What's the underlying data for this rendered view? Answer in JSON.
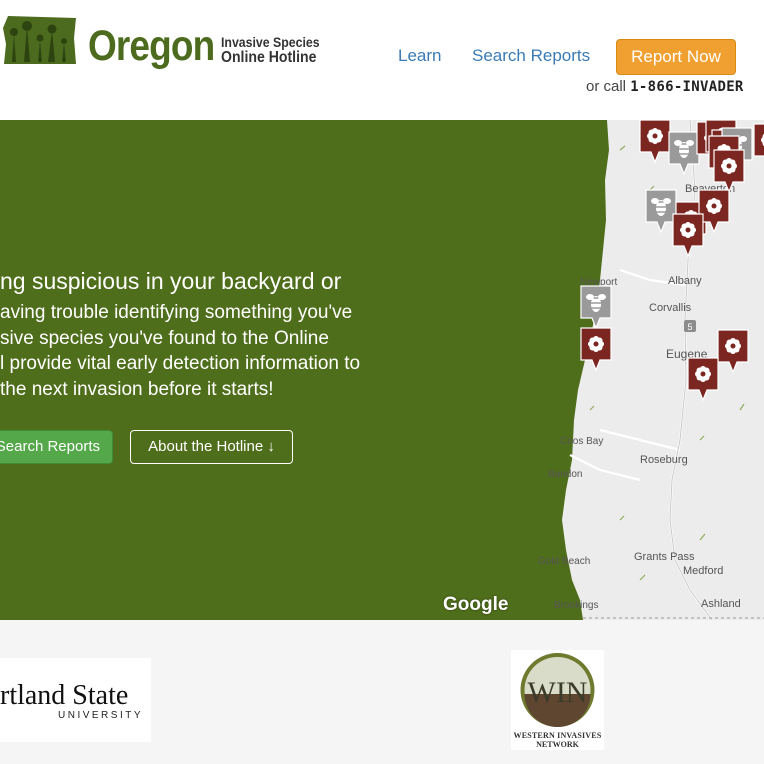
{
  "header": {
    "logo": {
      "wordmark": "Oregon",
      "subtitle_line1": "Invasive Species",
      "subtitle_line2": "Online Hotline"
    },
    "nav": [
      {
        "label": "Learn"
      },
      {
        "label": "Search Reports"
      }
    ],
    "report_button": "Report Now",
    "call_prefix": "or call",
    "phone": "1-866-INVADER"
  },
  "hero": {
    "title": "ng suspicious in your backyard or",
    "body_lines": [
      "aving trouble identifying something you've",
      "sive species you've found to the Online",
      "l provide vital early detection information to",
      " the next invasion before it starts!"
    ],
    "search_button": "Search Reports",
    "about_button": "About the Hotline ↓",
    "background_color": "#4f6e1b"
  },
  "map": {
    "google_mark": "Google",
    "places": [
      {
        "name": "Beaverton"
      },
      {
        "name": "Newport"
      },
      {
        "name": "Albany"
      },
      {
        "name": "Corvallis"
      },
      {
        "name": "Eugene"
      },
      {
        "name": "Coos Bay"
      },
      {
        "name": "Bandon"
      },
      {
        "name": "Roseburg"
      },
      {
        "name": "Gold Beach"
      },
      {
        "name": "Grants Pass"
      },
      {
        "name": "Medford"
      },
      {
        "name": "Brookings"
      },
      {
        "name": "Ashland"
      }
    ],
    "route_shield": "5",
    "marker_colors": {
      "plant": "#7b2621",
      "insect": "#9a9a9a"
    }
  },
  "footer": {
    "psu": {
      "name": "rtland State",
      "sub": "UNIVERSITY"
    },
    "win": {
      "letters": "WIN",
      "line1": "WESTERN INVASIVES",
      "line2": "NETWORK"
    }
  }
}
